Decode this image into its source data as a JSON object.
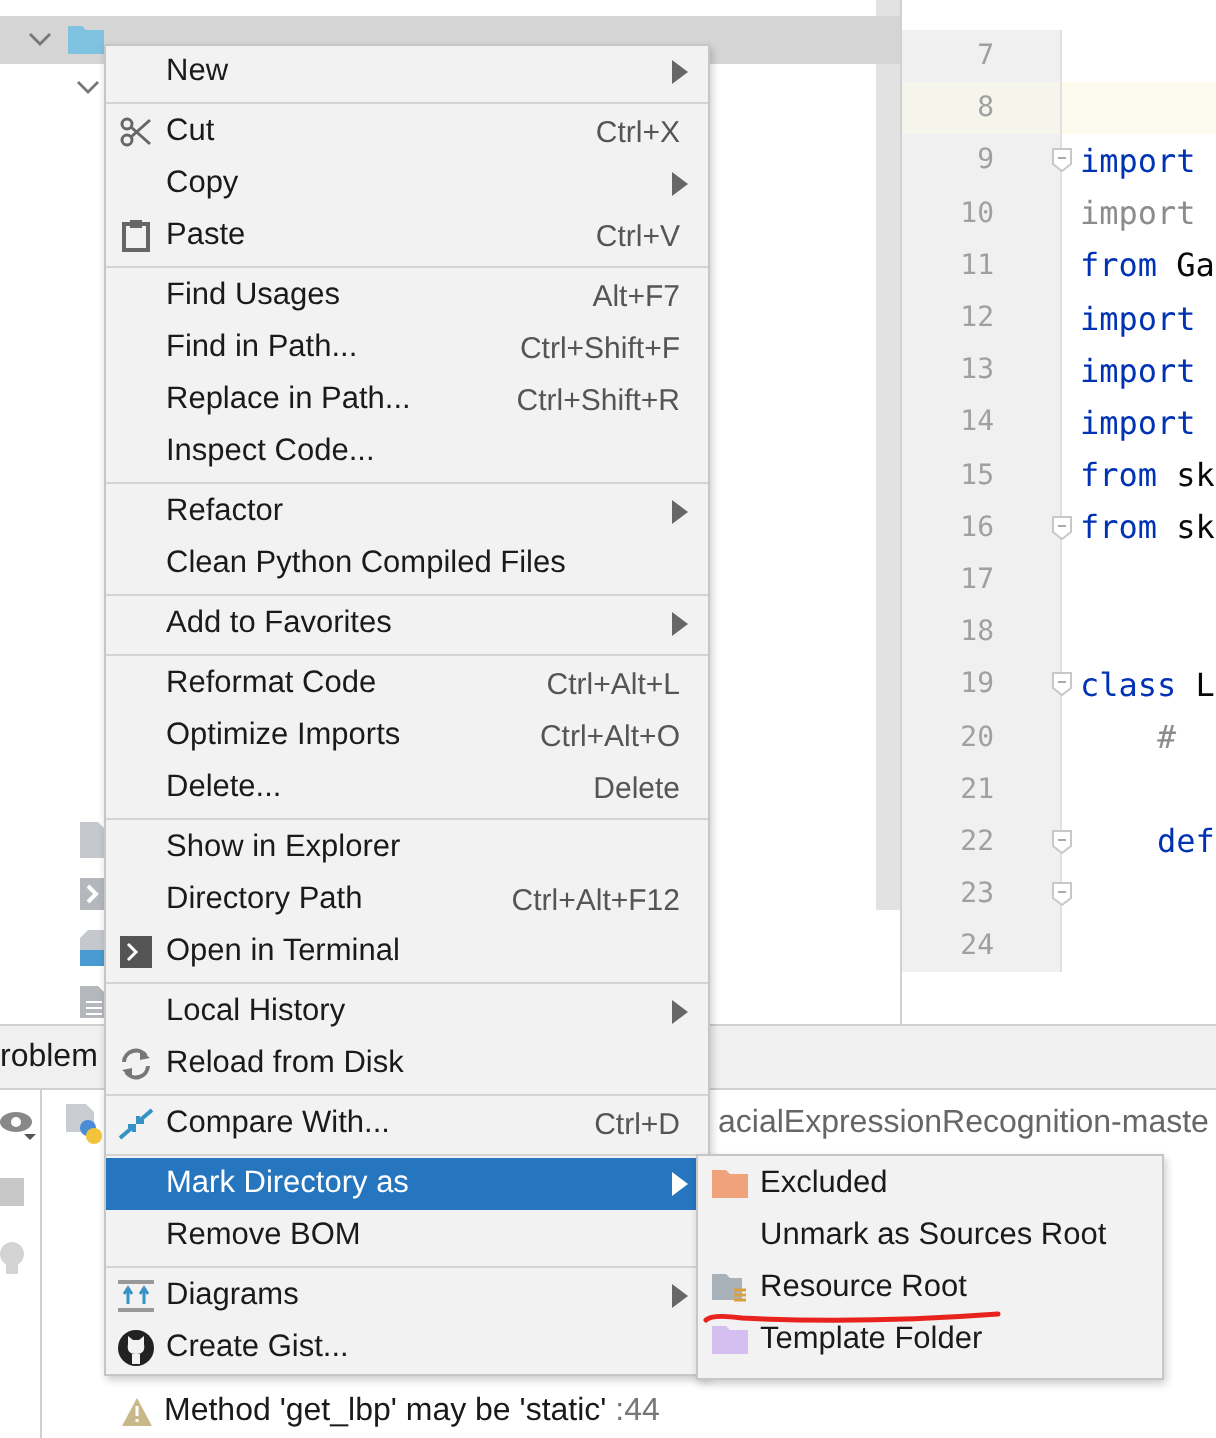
{
  "project_tree": [
    {
      "selected": true,
      "expanded": true,
      "children": [
        {
          "expanded": true
        }
      ]
    }
  ],
  "editor": {
    "lines": [
      {
        "number": "7",
        "current": false
      },
      {
        "number": "8",
        "current": true
      },
      {
        "number": "9",
        "current": false,
        "tokens": [
          {
            "text": "import",
            "kind": "keyword"
          }
        ]
      },
      {
        "number": "10",
        "current": false,
        "tokens": [
          {
            "text": "import",
            "kind": "unused"
          }
        ]
      },
      {
        "number": "11",
        "current": false,
        "tokens": [
          {
            "text": "from",
            "kind": "keyword"
          },
          {
            "text": " Ga",
            "kind": "name"
          }
        ]
      },
      {
        "number": "12",
        "current": false,
        "tokens": [
          {
            "text": "import",
            "kind": "keyword"
          }
        ]
      },
      {
        "number": "13",
        "current": false,
        "tokens": [
          {
            "text": "import",
            "kind": "keyword"
          }
        ]
      },
      {
        "number": "14",
        "current": false,
        "tokens": [
          {
            "text": "import",
            "kind": "keyword"
          }
        ]
      },
      {
        "number": "15",
        "current": false,
        "tokens": [
          {
            "text": "from",
            "kind": "keyword"
          },
          {
            "text": " sk",
            "kind": "name"
          }
        ]
      },
      {
        "number": "16",
        "current": false,
        "tokens": [
          {
            "text": "from",
            "kind": "keyword"
          },
          {
            "text": " sk",
            "kind": "name"
          }
        ]
      },
      {
        "number": "17",
        "current": false
      },
      {
        "number": "18",
        "current": false
      },
      {
        "number": "19",
        "current": false,
        "tokens": [
          {
            "text": "class",
            "kind": "keyword"
          },
          {
            "text": " L",
            "kind": "name"
          }
        ]
      },
      {
        "number": "20",
        "current": false,
        "tokens": [
          {
            "text": "    #",
            "kind": "comment"
          }
        ]
      },
      {
        "number": "21",
        "current": false
      },
      {
        "number": "22",
        "current": false,
        "tokens": [
          {
            "text": "    def",
            "kind": "keyword"
          }
        ]
      },
      {
        "number": "23",
        "current": false
      },
      {
        "number": "24",
        "current": false
      }
    ]
  },
  "problems": {
    "tab": "roblem",
    "file": "acialExpressionRecognition-maste",
    "warning": {
      "text": "Method 'get_lbp' may be 'static'",
      "location": " :44"
    }
  },
  "context_menu": {
    "groups": [
      [
        {
          "label": "New",
          "submenu": true,
          "selected": false
        }
      ],
      [
        {
          "label": "Cut",
          "shortcut": "Ctrl+X",
          "submenu": false,
          "selected": false
        },
        {
          "label": "Copy",
          "submenu": true,
          "selected": false
        },
        {
          "label": "Paste",
          "shortcut": "Ctrl+V",
          "submenu": false,
          "selected": false
        }
      ],
      [
        {
          "label": "Find Usages",
          "shortcut": "Alt+F7",
          "submenu": false,
          "selected": false
        },
        {
          "label": "Find in Path...",
          "shortcut": "Ctrl+Shift+F",
          "submenu": false,
          "selected": false
        },
        {
          "label": "Replace in Path...",
          "shortcut": "Ctrl+Shift+R",
          "submenu": false,
          "selected": false
        },
        {
          "label": "Inspect Code...",
          "submenu": false,
          "selected": false
        }
      ],
      [
        {
          "label": "Refactor",
          "submenu": true,
          "selected": false
        },
        {
          "label": "Clean Python Compiled Files",
          "submenu": false,
          "selected": false
        }
      ],
      [
        {
          "label": "Add to Favorites",
          "submenu": true,
          "selected": false
        }
      ],
      [
        {
          "label": "Reformat Code",
          "shortcut": "Ctrl+Alt+L",
          "submenu": false,
          "selected": false
        },
        {
          "label": "Optimize Imports",
          "shortcut": "Ctrl+Alt+O",
          "submenu": false,
          "selected": false
        },
        {
          "label": "Delete...",
          "shortcut": "Delete",
          "submenu": false,
          "selected": false
        }
      ],
      [
        {
          "label": "Show in Explorer",
          "submenu": false,
          "selected": false
        },
        {
          "label": "Directory Path",
          "shortcut": "Ctrl+Alt+F12",
          "submenu": false,
          "selected": false
        },
        {
          "label": "Open in Terminal",
          "submenu": false,
          "selected": false
        }
      ],
      [
        {
          "label": "Local History",
          "submenu": true,
          "selected": false
        },
        {
          "label": "Reload from Disk",
          "submenu": false,
          "selected": false
        }
      ],
      [
        {
          "label": "Compare With...",
          "shortcut": "Ctrl+D",
          "submenu": false,
          "selected": false
        }
      ],
      [
        {
          "label": "Mark Directory as",
          "submenu": true,
          "selected": true
        },
        {
          "label": "Remove BOM",
          "submenu": false,
          "selected": false
        }
      ],
      [
        {
          "label": "Diagrams",
          "submenu": true,
          "selected": false
        },
        {
          "label": "Create Gist...",
          "submenu": false,
          "selected": false
        }
      ]
    ]
  },
  "submenu": {
    "items": [
      {
        "label": "Excluded",
        "selected": false
      },
      {
        "label": "Unmark as Sources Root",
        "selected": false
      },
      {
        "label": "Resource Root",
        "selected": false
      },
      {
        "label": "Template Folder",
        "selected": false
      }
    ]
  }
}
